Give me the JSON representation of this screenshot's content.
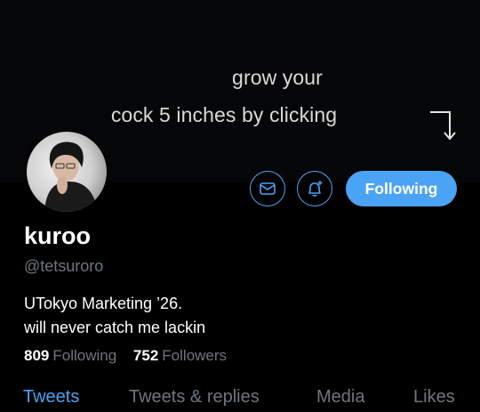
{
  "banner": {
    "line1": "grow your",
    "line2": "cock 5 inches by clicking"
  },
  "profile": {
    "name": "kuroo",
    "handle": "@tetsuroro",
    "bio_line1": "UTokyo Marketing ’26.",
    "bio_line2": "will never catch me lackin",
    "following_count": "809",
    "following_label": "Following",
    "followers_count": "752",
    "followers_label": "Followers"
  },
  "actions": {
    "message_icon": "envelope-icon",
    "notify_icon": "bell-plus-icon",
    "follow_label": "Following"
  },
  "tabs": [
    {
      "label": "Tweets",
      "active": true
    },
    {
      "label": "Tweets & replies",
      "active": false
    },
    {
      "label": "Media",
      "active": false
    },
    {
      "label": "Likes",
      "active": false
    }
  ],
  "colors": {
    "accent": "#4ba3f5",
    "muted": "#6e767d",
    "background": "#000000"
  }
}
